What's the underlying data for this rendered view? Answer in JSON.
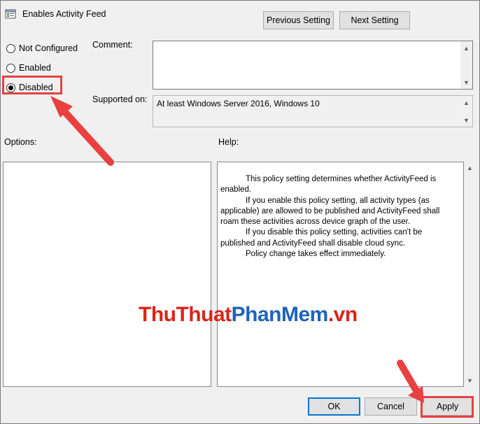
{
  "window": {
    "title": "Enables Activity Feed",
    "icon": "policy-setting-icon"
  },
  "navigation": {
    "previous_label": "Previous Setting",
    "next_label": "Next Setting"
  },
  "state_options": [
    {
      "label": "Not Configured",
      "selected": false
    },
    {
      "label": "Enabled",
      "selected": false
    },
    {
      "label": "Disabled",
      "selected": true
    }
  ],
  "comment": {
    "label": "Comment:",
    "value": ""
  },
  "supported_on": {
    "label": "Supported on:",
    "value": "At least Windows Server 2016, Windows 10"
  },
  "options": {
    "label": "Options:"
  },
  "help": {
    "label": "Help:",
    "paragraphs": [
      "This policy setting determines whether ActivityFeed is enabled.",
      "If you enable this policy setting, all activity types (as applicable) are allowed to be published and ActivityFeed shall roam these activities across device graph of the user.",
      "If you disable this policy setting, activities can't be published and ActivityFeed shall disable cloud sync.",
      "Policy change takes effect immediately."
    ]
  },
  "watermark": {
    "part1": "ThuThuat",
    "part2": "PhanMem",
    "part3": ".vn"
  },
  "footer": {
    "ok_label": "OK",
    "cancel_label": "Cancel",
    "apply_label": "Apply"
  },
  "colors": {
    "annotation": "#e94040",
    "accent": "#0078d7"
  }
}
